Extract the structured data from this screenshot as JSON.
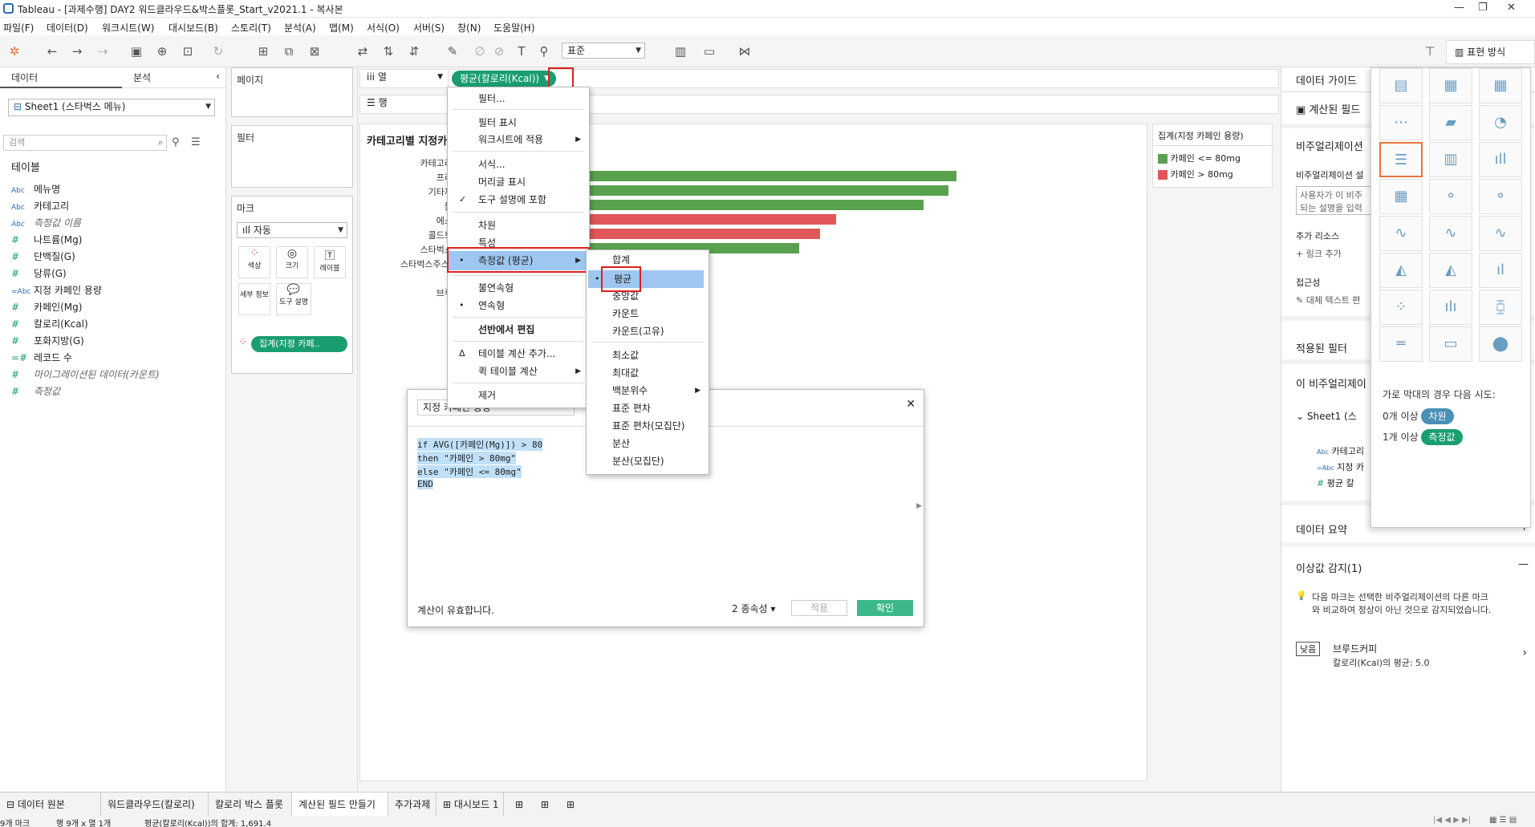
{
  "window": {
    "title": "Tableau - [과제수행] DAY2 워드클라우드&박스플롯_Start_v2021.1 - 복사본"
  },
  "menubar": [
    "파일(F)",
    "데이터(D)",
    "워크시트(W)",
    "대시보드(B)",
    "스토리(T)",
    "분석(A)",
    "맵(M)",
    "서식(O)",
    "서버(S)",
    "창(N)",
    "도움말(H)"
  ],
  "toolbar": {
    "fit_select": "표준",
    "show_me": "표현 방식"
  },
  "data_pane": {
    "tab_data": "데이터",
    "tab_analysis": "분석",
    "datasource": "Sheet1 (스타벅스 메뉴)",
    "search_placeholder": "검색",
    "section_tables": "테이블",
    "fields": [
      {
        "type": "Abc",
        "name": "메뉴명",
        "italic": false
      },
      {
        "type": "Abc",
        "name": "카테고리",
        "italic": false
      },
      {
        "type": "Abc",
        "name": "측정값 이름",
        "italic": true
      },
      {
        "type": "#",
        "name": "나트륨(Mg)",
        "italic": false
      },
      {
        "type": "#",
        "name": "단백질(G)",
        "italic": false
      },
      {
        "type": "#",
        "name": "당류(G)",
        "italic": false
      },
      {
        "type": "=Abc",
        "name": "지정 카페인 용량",
        "italic": false
      },
      {
        "type": "#",
        "name": "카페인(Mg)",
        "italic": false
      },
      {
        "type": "#",
        "name": "칼로리(Kcal)",
        "italic": false
      },
      {
        "type": "#",
        "name": "포화지방(G)",
        "italic": false
      },
      {
        "type": "=#",
        "name": "레코드 수",
        "italic": false
      },
      {
        "type": "#",
        "name": "마이그레이션된 데이터(카운트)",
        "italic": true
      },
      {
        "type": "#",
        "name": "측정값",
        "italic": true
      }
    ]
  },
  "cards": {
    "pages": "페이지",
    "filters": "필터",
    "marks": "마크",
    "mark_type": "자동",
    "mark_buttons": [
      "색상",
      "크기",
      "레이블",
      "세부 정보",
      "도구 설명"
    ],
    "color_pill": "집계(지정 카페.."
  },
  "shelves": {
    "columns_label": "열",
    "rows_label": "행",
    "columns_pill": "평균(칼로리(Kcal))"
  },
  "view": {
    "title": "카테고리별 지정카",
    "ylabels": [
      "카테고리",
      "프라",
      "기타제",
      "블",
      "에스",
      "콜드브",
      "스타벅스",
      "스타벅스주스(",
      "",
      "브루"
    ]
  },
  "chart_data": {
    "type": "bar",
    "categories": [
      "프라",
      "기타제",
      "블",
      "에스",
      "콜드브",
      "스타벅스"
    ],
    "values": [
      1132,
      1114,
      1058,
      860,
      824,
      776
    ],
    "series_colors": [
      "#59a14f",
      "#59a14f",
      "#59a14f",
      "#e15759",
      "#e15759",
      "#59a14f"
    ]
  },
  "legend": {
    "title": "집계(지정 카페인 용량)",
    "items": [
      {
        "label": "카페인 <= 80mg",
        "color": "#59a14f"
      },
      {
        "label": "카페인 > 80mg",
        "color": "#e15759"
      }
    ]
  },
  "context_menu": {
    "items": [
      "필터...",
      "필터 표시",
      "워크시트에 적용",
      "서식...",
      "머리글 표시",
      "도구 설명에 포함",
      "차원",
      "특성",
      "측정값 (평균)",
      "불연속형",
      "연속형",
      "선반에서 편집",
      "테이블 계산 추가...",
      "퀵 테이블 계산",
      "제거"
    ]
  },
  "sub_menu": {
    "items": [
      "합계",
      "평균",
      "중앙값",
      "카운트",
      "카운트(고유)",
      "최소값",
      "최대값",
      "백분위수",
      "표준 편차",
      "표준 편차(모집단)",
      "분산",
      "분산(모집단)"
    ]
  },
  "calc_dialog": {
    "name": "지정 카페인 용량",
    "code": [
      "if AVG([카페인(Mg)]) > 80",
      "then \"카페인 > 80mg\"",
      "else \"카페인 <= 80mg\"",
      "END"
    ],
    "status": "계산이 유효합니다.",
    "deps": "2 종속성",
    "apply": "적용",
    "ok": "확인"
  },
  "right_pane": {
    "guide_title": "데이터 가이드",
    "calc_field": "계산된 필드",
    "viz": "비주얼리제이션",
    "viz_desc": "비주얼리제이션 설",
    "desc_placeholder_1": "사용자가 이 비주",
    "desc_placeholder_2": "되는 설명을 입력",
    "resources": "추가 리소스",
    "add_link": "링크 추가",
    "accessibility": "접근성",
    "alt_text": "대체 텍스트 편",
    "applied_filters": "적용된 필터",
    "this_viz": "이 비주얼리제이",
    "sheet": "Sheet1 (스",
    "sheet_fields": [
      {
        "type": "Abc",
        "name": "카테고리"
      },
      {
        "type": "=Abc",
        "name": "지정 카"
      },
      {
        "type": "#",
        "name": "평균 칼"
      }
    ],
    "data_summary": "데이터 요약",
    "outliers": "이상값 감지(1)",
    "outliers_desc_1": "다음 마크는 선택한 비주얼리제이션의 다른 마크",
    "outliers_desc_2": "와 비교하여 정상이 아닌 것으로 감지되었습니다.",
    "badge": "낮음",
    "outlier_name": "브루드커피",
    "outlier_value": "칼로리(Kcal)의 평균: 5.0"
  },
  "show_me": {
    "hint": "가로 막대의 경우 다음 시도:",
    "row1_label": "0개 이상",
    "row1_pill": "차원",
    "row2_label": "1개 이상",
    "row2_pill": "측정값"
  },
  "tabs": [
    "데이터 원본",
    "워드클라우드(칼로리)",
    "칼로리 박스 플롯",
    "계산된 필드 만들기",
    "추가과제",
    "대시보드 1"
  ],
  "status_bar": {
    "marks": "9개 마크",
    "rows_cols": "행 9개 x 열 1개",
    "sum": "평균(칼로리(Kcal))의 합계: 1,691.4"
  }
}
